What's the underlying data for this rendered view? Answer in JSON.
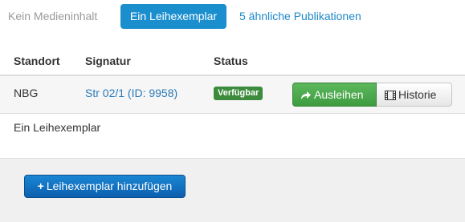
{
  "tabs": [
    {
      "label": "Kein Medieninhalt"
    },
    {
      "label": "Ein Leihexemplar"
    },
    {
      "label": "5 ähnliche Publikationen"
    }
  ],
  "table": {
    "headers": [
      "Standort",
      "Signatur",
      "Status"
    ],
    "rows": [
      {
        "standort": "NBG",
        "signatur": "Str 02/1 (ID: 9958)",
        "status": "Verfügbar",
        "actions": {
          "ausleihen": "Ausleihen",
          "historie": "Historie"
        }
      }
    ]
  },
  "caption": "Ein Leihexemplar",
  "footer": {
    "add_button": "Leihexemplar hinzufügen"
  },
  "colors": {
    "accent": "#1b8fce",
    "success": "#5cb85c",
    "badge": "#3d8b3d",
    "primary": "#0c5fae"
  },
  "icons": {
    "ausleihen": "share-arrow-icon",
    "historie": "film-icon",
    "add": "plus-icon"
  }
}
